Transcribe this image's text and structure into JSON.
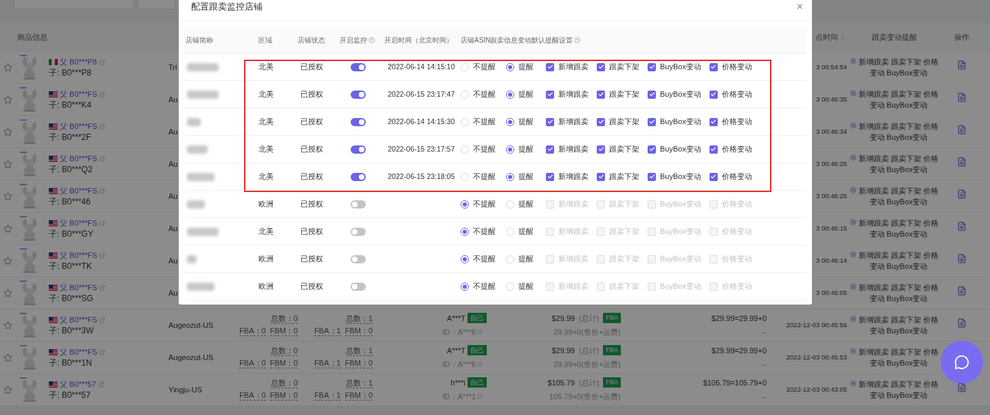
{
  "table": {
    "columns": {
      "product": "商品信息",
      "time": "点时间",
      "reminder": "跟卖变动提醒",
      "action": "操作"
    },
    "rows": [
      {
        "starred": false,
        "kind": "mx",
        "parent": "父 B0***P8",
        "child": "子: B0***P8",
        "store": "Tri",
        "time": "3 00:54:54",
        "reminder": "新增跟卖 跟卖下架 价格变动 BuyBox变动"
      },
      {
        "starred": false,
        "kind": "us",
        "parent": "父 B0***FS",
        "child": "子: B0***K4",
        "store": "Au",
        "time": "3 00:46:35",
        "reminder": "新增跟卖 跟卖下架 价格变动 BuyBox变动"
      },
      {
        "starred": false,
        "kind": "us",
        "parent": "父 B0***FS",
        "child": "子: B0***2F",
        "store": "Au",
        "time": "3 00:46:34",
        "reminder": "新增跟卖 跟卖下架 价格变动 BuyBox变动"
      },
      {
        "starred": false,
        "kind": "us",
        "parent": "父 B0***FS",
        "child": "子: B0***Q2",
        "store": "Au",
        "time": "3 00:46:25",
        "reminder": "新增跟卖 跟卖下架 价格变动 BuyBox变动"
      },
      {
        "starred": false,
        "kind": "us",
        "parent": "父 B0***FS",
        "child": "子: B0***46",
        "store": "Au",
        "time": "3 00:46:25",
        "reminder": "新增跟卖 跟卖下架 价格变动 BuyBox变动"
      },
      {
        "starred": false,
        "kind": "us",
        "parent": "父 B0***FS",
        "child": "子: B0***GY",
        "store": "Au",
        "time": "3 00:46:15",
        "reminder": "新增跟卖 跟卖下架 价格变动 BuyBox变动"
      },
      {
        "starred": false,
        "kind": "us",
        "parent": "父 B0***FS",
        "child": "子: B0***TK",
        "store": "Au",
        "time": "3 00:46:14",
        "reminder": "新增跟卖 跟卖下架 价格变动 BuyBox变动"
      },
      {
        "starred": false,
        "kind": "us",
        "parent": "父 B0***FS",
        "child": "子: B0***SG",
        "store": "Au",
        "time": "3 00:46:05",
        "reminder": "新增跟卖 跟卖下架 价格变动 BuyBox变动"
      },
      {
        "starred": false,
        "kind": "us",
        "parent": "父 B0***FS",
        "child": "子: B0***3W",
        "store": "Augeozut-US",
        "counts_a": {
          "total": "总数：0",
          "fba": "FBA：0",
          "fbm": "FBM：0"
        },
        "counts_b": {
          "total": "总数：1",
          "fba": "FBA：1",
          "fbm": "FBM：0"
        },
        "seller": {
          "name": "A***T",
          "badge": "自己",
          "id": "ID：A***6"
        },
        "price": {
          "amount": "$29.99",
          "note": "(总计)",
          "badge": "FBA",
          "detail": "29.99+0(售价+运费)"
        },
        "sum": {
          "formula": "$29.99=29.99+0",
          "extra": "--"
        },
        "time": "2022-12-03 00:45:56",
        "reminder": "新增跟卖 跟卖下架 价格变动 BuyBox变动"
      },
      {
        "starred": false,
        "kind": "us",
        "parent": "父 B0***FS",
        "child": "子: B0***1N",
        "doc": false,
        "store": "Augeozut-US",
        "counts_a": {
          "total": "总数：0",
          "fba": "FBA：0",
          "fbm": "FBM：0"
        },
        "counts_b": {
          "total": "总数：1",
          "fba": "FBA：1",
          "fbm": "FBM：0"
        },
        "seller": {
          "name": "A***T",
          "badge": "自己",
          "id": "ID：A***6"
        },
        "price": {
          "amount": "$29.99",
          "note": "(总计)",
          "badge": "FBA",
          "detail": "29.99+0(售价+运费)"
        },
        "sum": {
          "formula": "$29.99=29.99+0",
          "extra": "--"
        },
        "time": "2022-12-03 00:45:53",
        "reminder": "新增跟卖 跟卖下架 价格变动 BuyBox变动"
      },
      {
        "starred": false,
        "kind": "us",
        "parent": "父 B0***57",
        "child": "子: B0***57",
        "store": "Yingju-US",
        "counts_a": {
          "total": "总数：0",
          "fba": "FBA：0",
          "fbm": "FBM：0"
        },
        "counts_b": {
          "total": "总数：1",
          "fba": "FBA：1",
          "fbm": "FBM：0"
        },
        "seller": {
          "name": "h***i",
          "badge": "自己",
          "id": "ID：A***1"
        },
        "price": {
          "amount": "$105.79",
          "note": "(总计)",
          "badge": "FBA",
          "detail": "105.79+0(售价+运费)"
        },
        "sum": {
          "formula": "$105.79=105.79+0",
          "extra": "--"
        },
        "time": "2022-12-03 00:43:05",
        "reminder": "新增跟卖 跟卖下架 价格变动 BuyBox变动"
      }
    ]
  },
  "modal": {
    "title": "配置跟卖监控店铺",
    "close": "×",
    "columns": [
      {
        "label": "店铺简称"
      },
      {
        "label": "区域"
      },
      {
        "label": "店铺状态"
      },
      {
        "label": "开启监控",
        "help": true
      },
      {
        "label": "开启时间（北京时间）"
      },
      {
        "label": "店铺ASIN跟卖信息变动默认提醒设置",
        "help": true
      }
    ],
    "stores": [
      {
        "highlighted": true,
        "region": "北美",
        "status": "已授权",
        "monitoring": true,
        "start_time": "2022-06-14 14:15:10",
        "reminder": [
          {
            "label": "不提醒",
            "selected": false
          },
          {
            "label": "提醒",
            "selected": true
          }
        ],
        "alerts": [
          {
            "label": "新增跟卖",
            "checked": true,
            "disabled": false
          },
          {
            "label": "跟卖下架",
            "checked": true,
            "disabled": false
          },
          {
            "label": "BuyBox变动",
            "checked": true,
            "disabled": false
          },
          {
            "label": "价格变动",
            "checked": true,
            "disabled": false
          }
        ]
      },
      {
        "highlighted": true,
        "region": "北美",
        "status": "已授权",
        "monitoring": true,
        "start_time": "2022-06-15 23:17:47",
        "reminder": [
          {
            "label": "不提醒",
            "selected": false
          },
          {
            "label": "提醒",
            "selected": true
          }
        ],
        "alerts": [
          {
            "label": "新增跟卖",
            "checked": true,
            "disabled": false
          },
          {
            "label": "跟卖下架",
            "checked": true,
            "disabled": false
          },
          {
            "label": "BuyBox变动",
            "checked": true,
            "disabled": false
          },
          {
            "label": "价格变动",
            "checked": true,
            "disabled": false
          }
        ]
      },
      {
        "highlighted": true,
        "region": "北美",
        "status": "已授权",
        "monitoring": true,
        "start_time": "2022-06-14 14:15:30",
        "reminder": [
          {
            "label": "不提醒",
            "selected": false
          },
          {
            "label": "提醒",
            "selected": true
          }
        ],
        "alerts": [
          {
            "label": "新增跟卖",
            "checked": true,
            "disabled": false
          },
          {
            "label": "跟卖下架",
            "checked": true,
            "disabled": false
          },
          {
            "label": "BuyBox变动",
            "checked": true,
            "disabled": false
          },
          {
            "label": "价格变动",
            "checked": true,
            "disabled": false
          }
        ]
      },
      {
        "highlighted": true,
        "region": "北美",
        "status": "已授权",
        "monitoring": true,
        "start_time": "2022-06-15 23:17:57",
        "reminder": [
          {
            "label": "不提醒",
            "selected": false
          },
          {
            "label": "提醒",
            "selected": true
          }
        ],
        "alerts": [
          {
            "label": "新增跟卖",
            "checked": true,
            "disabled": false
          },
          {
            "label": "跟卖下架",
            "checked": true,
            "disabled": false
          },
          {
            "label": "BuyBox变动",
            "checked": true,
            "disabled": false
          },
          {
            "label": "价格变动",
            "checked": true,
            "disabled": false
          }
        ]
      },
      {
        "highlighted": true,
        "region": "北美",
        "status": "已授权",
        "monitoring": true,
        "start_time": "2022-06-15 23:18:05",
        "reminder": [
          {
            "label": "不提醒",
            "selected": false
          },
          {
            "label": "提醒",
            "selected": true
          }
        ],
        "alerts": [
          {
            "label": "新增跟卖",
            "checked": true,
            "disabled": false
          },
          {
            "label": "跟卖下架",
            "checked": true,
            "disabled": false
          },
          {
            "label": "BuyBox变动",
            "checked": true,
            "disabled": false
          },
          {
            "label": "价格变动",
            "checked": true,
            "disabled": false
          }
        ]
      },
      {
        "highlighted": false,
        "region": "欧洲",
        "status": "已授权",
        "monitoring": false,
        "reminder": [
          {
            "label": "不提醒",
            "selected": true
          },
          {
            "label": "提醒",
            "selected": false
          }
        ],
        "alerts": [
          {
            "label": "新增跟卖",
            "checked": false,
            "disabled": true
          },
          {
            "label": "跟卖下架",
            "checked": false,
            "disabled": true
          },
          {
            "label": "BuyBox变动",
            "checked": false,
            "disabled": true
          },
          {
            "label": "价格变动",
            "checked": false,
            "disabled": true
          }
        ]
      },
      {
        "highlighted": false,
        "region": "北美",
        "status": "已授权",
        "monitoring": false,
        "reminder": [
          {
            "label": "不提醒",
            "selected": true
          },
          {
            "label": "提醒",
            "selected": false
          }
        ],
        "alerts": [
          {
            "label": "新增跟卖",
            "checked": false,
            "disabled": true
          },
          {
            "label": "跟卖下架",
            "checked": false,
            "disabled": true
          },
          {
            "label": "BuyBox变动",
            "checked": false,
            "disabled": true
          },
          {
            "label": "价格变动",
            "checked": false,
            "disabled": true
          }
        ]
      },
      {
        "highlighted": false,
        "region": "欧洲",
        "status": "已授权",
        "monitoring": false,
        "reminder": [
          {
            "label": "不提醒",
            "selected": true
          },
          {
            "label": "提醒",
            "selected": false
          }
        ],
        "alerts": [
          {
            "label": "新增跟卖",
            "checked": false,
            "disabled": true
          },
          {
            "label": "跟卖下架",
            "checked": false,
            "disabled": true
          },
          {
            "label": "BuyBox变动",
            "checked": false,
            "disabled": true
          },
          {
            "label": "价格变动",
            "checked": false,
            "disabled": true
          }
        ]
      },
      {
        "highlighted": false,
        "region": "欧洲",
        "status": "已授权",
        "monitoring": false,
        "reminder": [
          {
            "label": "不提醒",
            "selected": true
          },
          {
            "label": "提醒",
            "selected": false
          }
        ],
        "alerts": [
          {
            "label": "新增跟卖",
            "checked": false,
            "disabled": true
          },
          {
            "label": "跟卖下架",
            "checked": false,
            "disabled": true
          },
          {
            "label": "BuyBox变动",
            "checked": false,
            "disabled": true
          },
          {
            "label": "价格变动",
            "checked": false,
            "disabled": true
          }
        ]
      }
    ]
  }
}
